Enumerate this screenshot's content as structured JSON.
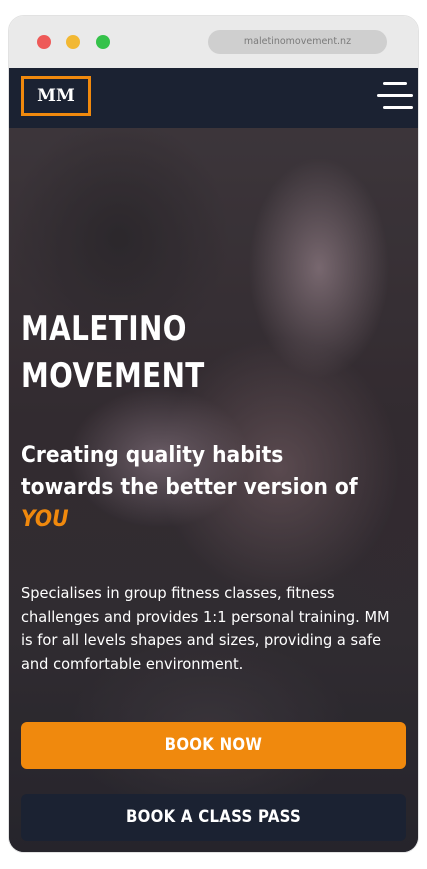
{
  "browser": {
    "url": "maletinomovement.nz"
  },
  "nav": {
    "logo_text": "MM",
    "menu_icon": "hamburger-menu-icon"
  },
  "hero": {
    "title_line1": "MALETINO",
    "title_line2": "MOVEMENT",
    "subtitle": "Creating quality habits towards the better version of",
    "highlight": "YOU",
    "description": "Specialises in group fitness classes, fitness challenges and provides 1:1 personal training. MM is for all levels shapes and sizes, providing a safe and comfortable environment."
  },
  "buttons": {
    "book_now": "BOOK NOW",
    "book_class_pass": "BOOK A CLASS PASS"
  },
  "colors": {
    "accent": "#f0890d",
    "navy": "#1b2232",
    "browser_chrome": "#eaeaea",
    "dot_red": "#ee5a58",
    "dot_yellow": "#f2b833",
    "dot_green": "#35c24a"
  }
}
